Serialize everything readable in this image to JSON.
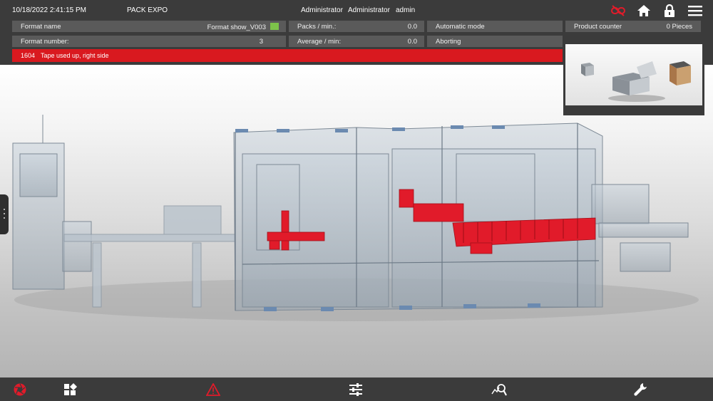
{
  "header": {
    "datetime": "10/18/2022 2:41:15 PM",
    "project": "PACK EXPO",
    "user_role_1": "Administrator",
    "user_role_2": "Administrator",
    "username": "admin"
  },
  "info": {
    "format_name_label": "Format name",
    "format_name_value": "Format show_V003",
    "format_number_label": "Format number:",
    "format_number_value": "3",
    "packs_min_label": "Packs / min.:",
    "packs_min_value": "0.0",
    "average_min_label": "Average / min:",
    "average_min_value": "0.0",
    "mode": "Automatic mode",
    "state": "Aborting",
    "product_counter_label": "Product counter",
    "product_counter_value": "0 Pieces"
  },
  "alarm": {
    "code": "1604",
    "message": "Tape used up, right side"
  },
  "colors": {
    "alarm": "#d9191f",
    "format_swatch": "#7dc34a",
    "accent_red": "#e11b2a"
  },
  "icons": {
    "top": [
      "link-broken-icon",
      "home-icon",
      "lock-icon",
      "menu-icon"
    ],
    "bottom": [
      "aperture-icon",
      "dashboard-icon",
      "warning-icon",
      "sliders-icon",
      "search-graph-icon",
      "wrench-icon"
    ]
  }
}
